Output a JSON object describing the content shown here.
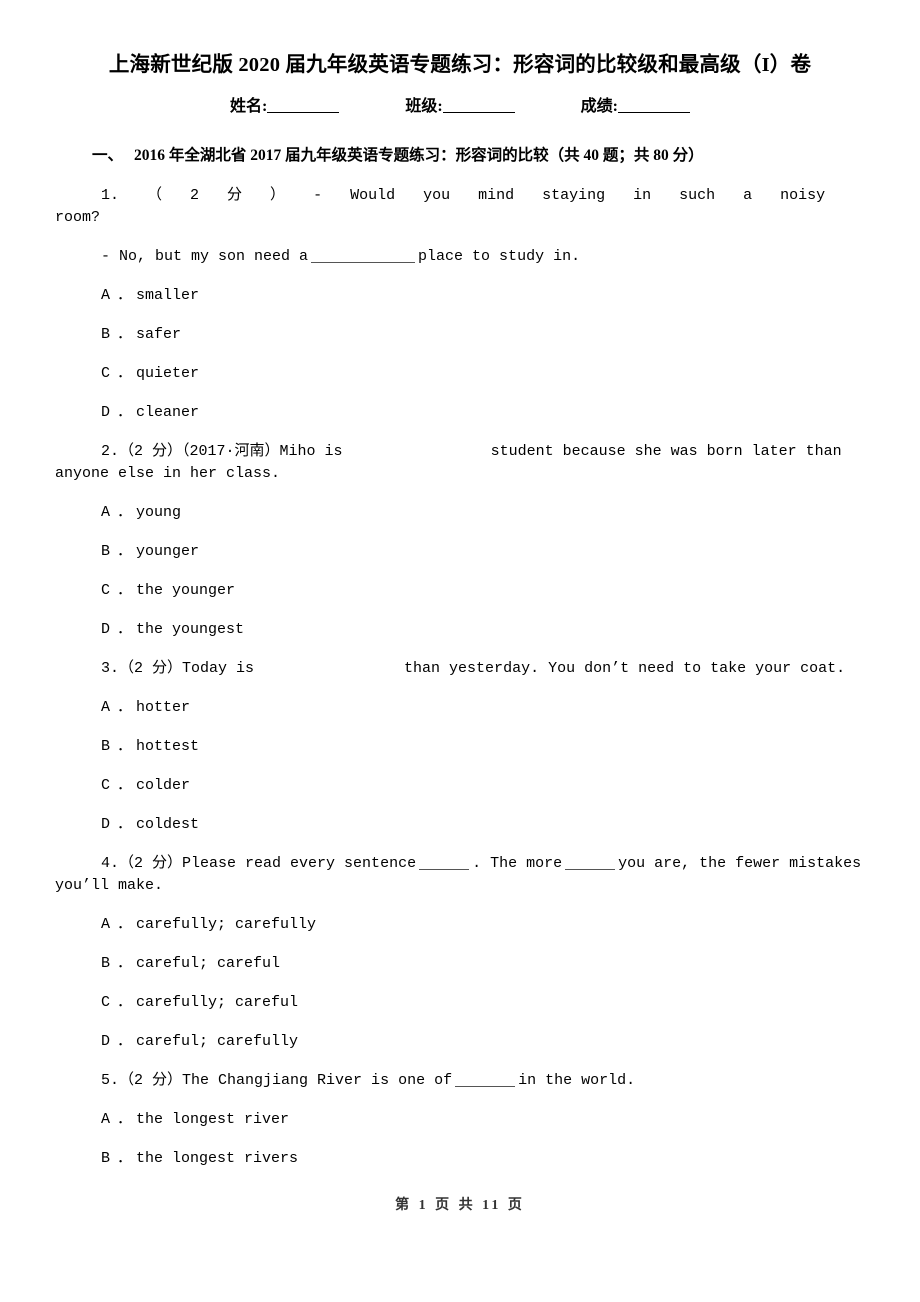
{
  "document": {
    "title": "上海新世纪版 2020 届九年级英语专题练习：形容词的比较级和最高级（I）卷",
    "meta": {
      "name_label": "姓名:",
      "class_label": "班级:",
      "score_label": "成绩:"
    },
    "section": {
      "number": "一、",
      "heading": "2016 年全湖北省 2017 届九年级英语专题练习：形容词的比较（共 40 题；共 80 分）"
    },
    "footer": "第 1 页 共 11 页"
  },
  "questions": [
    {
      "number": "1.",
      "points": "（ 2 分 ）",
      "stem_line1": "- Would you mind staying in such a noisy",
      "stem_line2": "room?",
      "stem_line3_pre": "- No, but my son need a",
      "stem_line3_post": "place to study in.",
      "options": [
        {
          "letter": "A",
          "text": "smaller"
        },
        {
          "letter": "B",
          "text": "safer"
        },
        {
          "letter": "C",
          "text": "quieter"
        },
        {
          "letter": "D",
          "text": "cleaner"
        }
      ]
    },
    {
      "number": "2.",
      "points": "（2 分）",
      "source": "（2017·河南）",
      "stem_pre": "Miho is",
      "stem_post": "student because she was born later than",
      "stem_line2": "anyone else in her class.",
      "options": [
        {
          "letter": "A",
          "text": "young"
        },
        {
          "letter": "B",
          "text": "younger"
        },
        {
          "letter": "C",
          "text": "the younger"
        },
        {
          "letter": "D",
          "text": "the youngest"
        }
      ]
    },
    {
      "number": "3.",
      "points": "（2 分）",
      "stem_pre": "Today is",
      "stem_post": "than yesterday. You don’t need to take your coat.",
      "options": [
        {
          "letter": "A",
          "text": "hotter"
        },
        {
          "letter": "B",
          "text": "hottest"
        },
        {
          "letter": "C",
          "text": "colder"
        },
        {
          "letter": "D",
          "text": "coldest"
        }
      ]
    },
    {
      "number": "4.",
      "points": "（2 分）",
      "stem_a": "Please read every sentence",
      "stem_b": ". The more",
      "stem_c": "you are, the fewer mistakes",
      "stem_line2": "you’ll make.",
      "options": [
        {
          "letter": "A",
          "text": "carefully; carefully"
        },
        {
          "letter": "B",
          "text": "careful; careful"
        },
        {
          "letter": "C",
          "text": "carefully; careful"
        },
        {
          "letter": "D",
          "text": "careful; carefully"
        }
      ]
    },
    {
      "number": "5.",
      "points": "（2 分）",
      "stem_pre": "The Changjiang River is one of",
      "stem_post": "in the world.",
      "options": [
        {
          "letter": "A",
          "text": "the longest river"
        },
        {
          "letter": "B",
          "text": "the longest rivers"
        }
      ]
    }
  ]
}
